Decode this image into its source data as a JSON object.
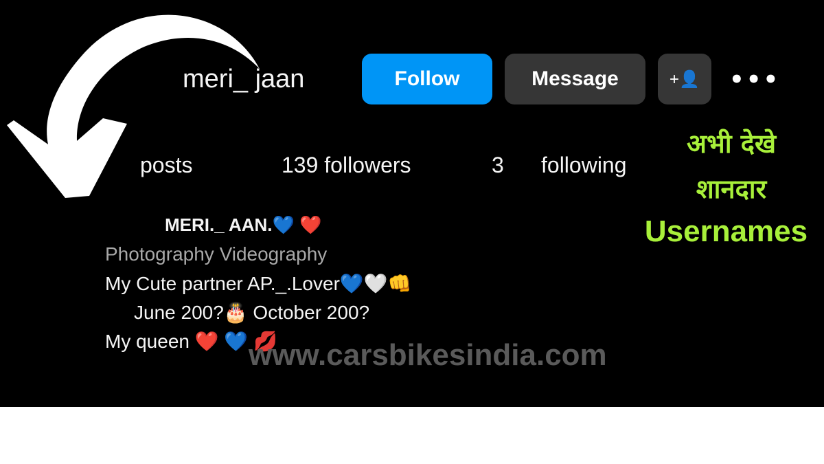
{
  "profile": {
    "username": "meri_ jaan",
    "follow_label": "Follow",
    "message_label": "Message",
    "add_user_icon": "+👤",
    "more_icon": "•••",
    "stats": {
      "posts": "posts",
      "followers": "139 followers",
      "following_count": "3",
      "following": "following"
    },
    "bio": {
      "name": "MERI._ AAN.💙 ❤️",
      "category": "Photography Videography",
      "line1": "My Cute partner AP._.Lover💙🤍👊",
      "line2": "June 200?🎂   October 200?",
      "line3": "My queen ❤️ 💙 💋"
    },
    "accent": "#0095f6"
  },
  "promo": {
    "line1": "अभी देखे",
    "line2": "शानदार",
    "line3": "Usernames",
    "color": "#a8f03a"
  },
  "watermark": "www.carsbikesindia.com"
}
